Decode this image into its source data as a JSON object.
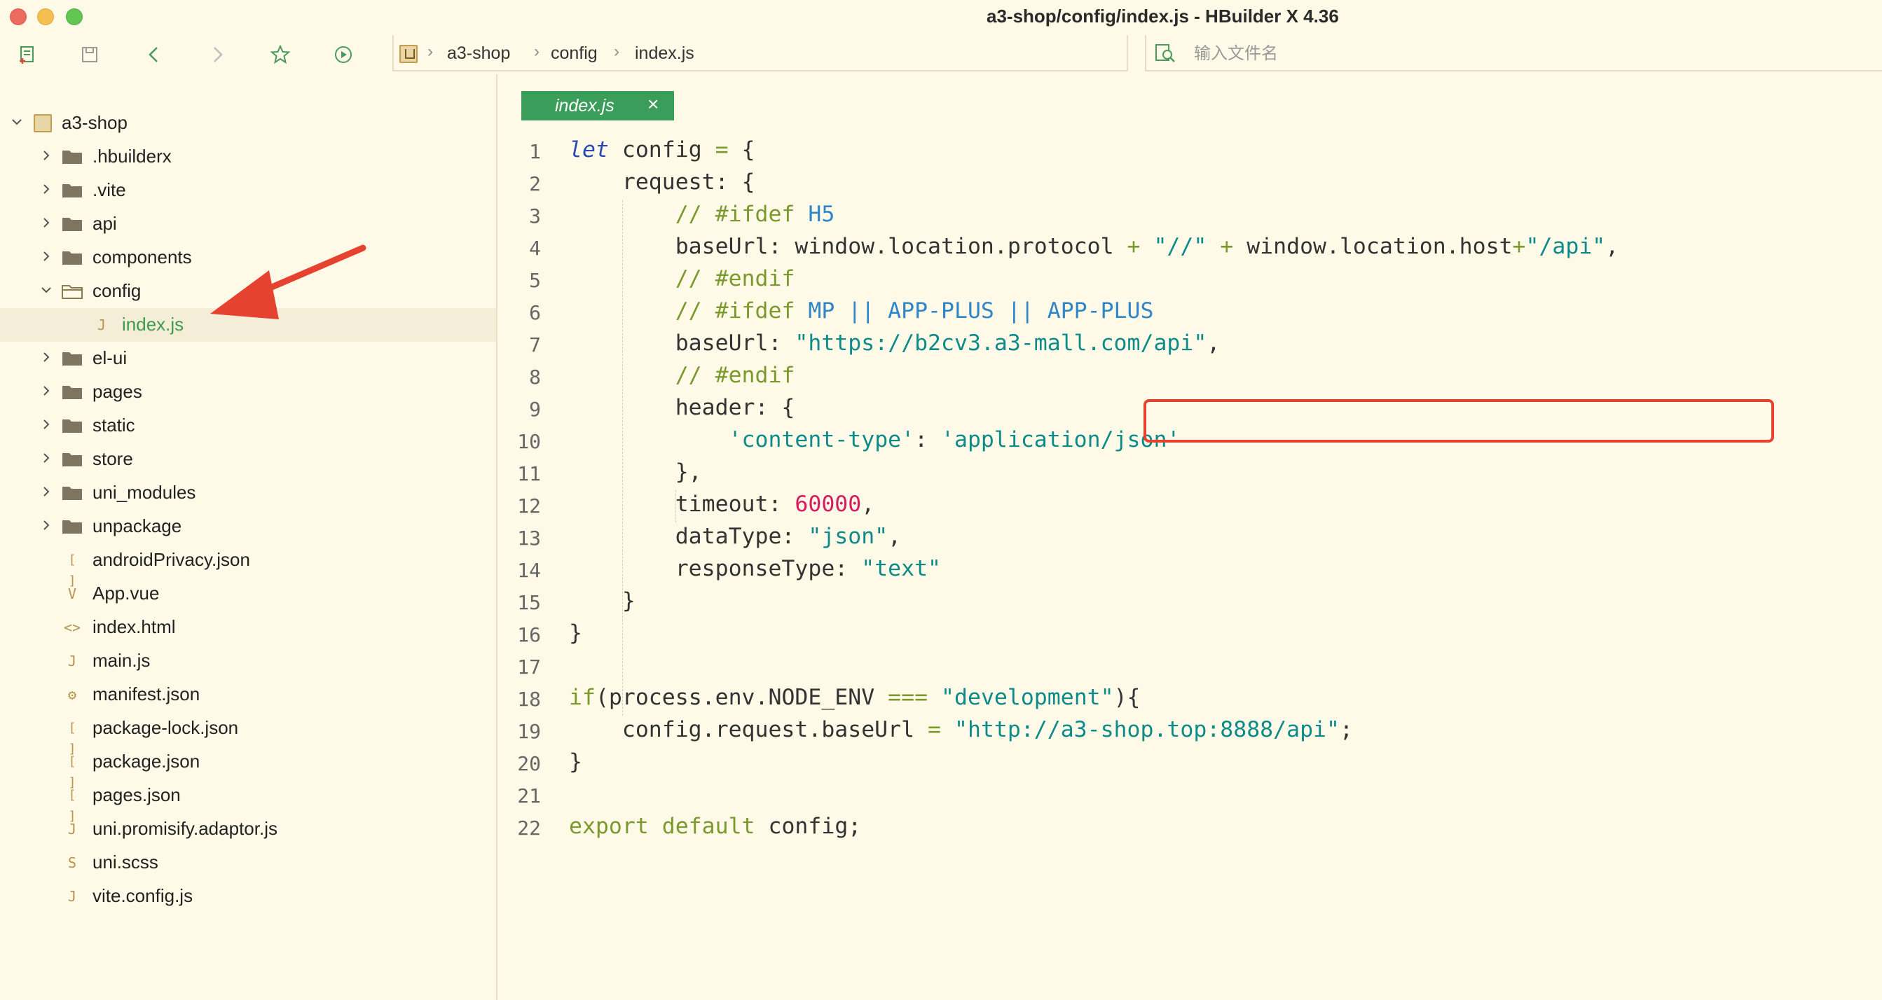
{
  "window": {
    "title": "a3-shop/config/index.js - HBuilder X 4.36"
  },
  "toolbar": {
    "breadcrumbs": [
      "a3-shop",
      "config",
      "index.js"
    ],
    "search_placeholder": "输入文件名",
    "icons": [
      "new-file-icon",
      "save-icon",
      "back-icon",
      "forward-icon",
      "star-icon",
      "run-icon"
    ]
  },
  "sidebar": {
    "project": "a3-shop",
    "items": [
      {
        "label": ".hbuilderx",
        "type": "folder"
      },
      {
        "label": ".vite",
        "type": "folder"
      },
      {
        "label": "api",
        "type": "folder"
      },
      {
        "label": "components",
        "type": "folder"
      },
      {
        "label": "config",
        "type": "folder-open"
      },
      {
        "label": "index.js",
        "type": "file-js"
      },
      {
        "label": "el-ui",
        "type": "folder"
      },
      {
        "label": "pages",
        "type": "folder"
      },
      {
        "label": "static",
        "type": "folder"
      },
      {
        "label": "store",
        "type": "folder"
      },
      {
        "label": "uni_modules",
        "type": "folder"
      },
      {
        "label": "unpackage",
        "type": "folder"
      },
      {
        "label": "androidPrivacy.json",
        "type": "file-json"
      },
      {
        "label": "App.vue",
        "type": "file-vue"
      },
      {
        "label": "index.html",
        "type": "file-html"
      },
      {
        "label": "main.js",
        "type": "file-js"
      },
      {
        "label": "manifest.json",
        "type": "file-manifest"
      },
      {
        "label": "package-lock.json",
        "type": "file-json"
      },
      {
        "label": "package.json",
        "type": "file-json"
      },
      {
        "label": "pages.json",
        "type": "file-json"
      },
      {
        "label": "uni.promisify.adaptor.js",
        "type": "file-js"
      },
      {
        "label": "uni.scss",
        "type": "file-scss"
      },
      {
        "label": "vite.config.js",
        "type": "file-js"
      }
    ]
  },
  "editor": {
    "tab_label": "index.js",
    "tab_close": "×",
    "line_numbers": [
      "1",
      "2",
      "3",
      "4",
      "5",
      "6",
      "7",
      "8",
      "9",
      "10",
      "11",
      "12",
      "13",
      "14",
      "15",
      "16",
      "17",
      "18",
      "19",
      "20",
      "21",
      "22"
    ],
    "lines": [
      "let config = {",
      "    request: {",
      "        // #ifdef H5",
      "        baseUrl: window.location.protocol + \"//\" + window.location.host+\"/api\",",
      "        // #endif",
      "        // #ifdef MP || APP-PLUS || APP-PLUS",
      "        baseUrl: \"https://b2cv3.a3-mall.com/api\",",
      "        // #endif",
      "        header: {",
      "            'content-type': 'application/json'",
      "        },",
      "        timeout: 60000,",
      "        dataType: \"json\",",
      "        responseType: \"text\"",
      "    }",
      "}",
      "",
      "if(process.env.NODE_ENV === \"development\"){",
      "    config.request.baseUrl = \"http://a3-shop.top:8888/api\";",
      "}",
      "",
      "export default config;"
    ]
  },
  "colors": {
    "background": "#fffae8",
    "tab_active": "#3a9e5a",
    "active_file": "#3d9b4d",
    "highlight_border": "#e5432f",
    "arrow": "#e5432f"
  }
}
